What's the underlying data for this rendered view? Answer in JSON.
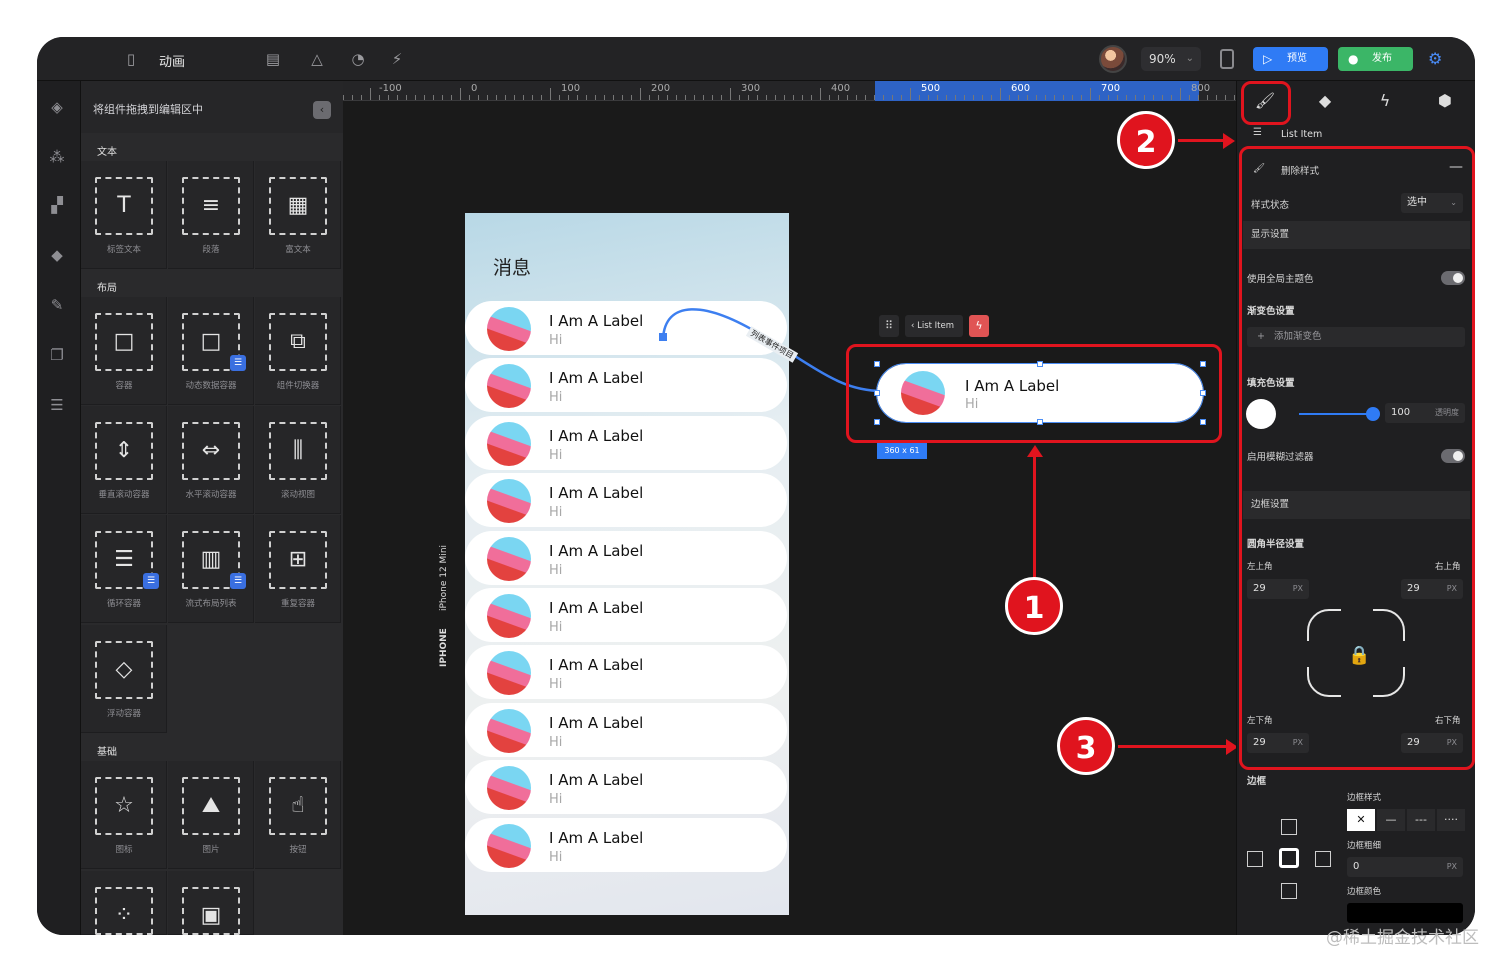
{
  "topbar": {
    "title": "动画",
    "zoom": "90%",
    "preview_label": "预览",
    "publish_label": "发布"
  },
  "panel": {
    "header": "将组件拖拽到编辑区中",
    "sections": {
      "text": "文本",
      "layout": "布局",
      "basic": "基础"
    },
    "text_items": [
      "标签文本",
      "段落",
      "富文本"
    ],
    "layout_items": [
      "容器",
      "动态数据容器",
      "组件切换器",
      "垂直滚动容器",
      "水平滚动容器",
      "滚动视图",
      "循环容器",
      "流式布局列表",
      "重复容器",
      "浮动容器"
    ],
    "basic_items": [
      "图标",
      "图片",
      "按钮"
    ]
  },
  "ruler": {
    "labels": [
      "-100",
      "0",
      "100",
      "200",
      "300",
      "400",
      "500",
      "600",
      "700",
      "800"
    ]
  },
  "phone": {
    "title": "消息",
    "device_model": "iPhone 12 Mini",
    "device_type": "IPHONE",
    "connector_label": "列表事件项目",
    "items": [
      {
        "label": "I Am A Label",
        "sub": "Hi"
      },
      {
        "label": "I Am A Label",
        "sub": "Hi"
      },
      {
        "label": "I Am A Label",
        "sub": "Hi"
      },
      {
        "label": "I Am A Label",
        "sub": "Hi"
      },
      {
        "label": "I Am A Label",
        "sub": "Hi"
      },
      {
        "label": "I Am A Label",
        "sub": "Hi"
      },
      {
        "label": "I Am A Label",
        "sub": "Hi"
      },
      {
        "label": "I Am A Label",
        "sub": "Hi"
      },
      {
        "label": "I Am A Label",
        "sub": "Hi"
      },
      {
        "label": "I Am A Label",
        "sub": "Hi"
      }
    ]
  },
  "selection": {
    "crumb": "List Item",
    "label": "I Am A Label",
    "sub": "Hi",
    "size": "360 x 61"
  },
  "annotations": [
    "1",
    "2",
    "3"
  ],
  "inspector": {
    "breadcrumb": "List Item",
    "style_header": "删除样式",
    "style_state_label": "样式状态",
    "style_state_value": "选中",
    "display_settings": "显示设置",
    "use_global_theme": "使用全局主题色",
    "gradient_settings": "渐变色设置",
    "add_gradient": "添加渐变色",
    "fill_settings": "填充色设置",
    "opacity_value": "100",
    "opacity_label": "透明度",
    "blur_filter": "启用模糊过滤器",
    "border_settings": "边框设置",
    "radius_settings": "圆角半径设置",
    "top_left": "左上角",
    "top_right": "右上角",
    "bottom_left": "左下角",
    "bottom_right": "右下角",
    "radius_value": "29",
    "unit": "PX",
    "border_title": "边框",
    "border_style": "边框样式",
    "border_width": "边框粗细",
    "border_width_value": "0",
    "border_color": "边框颜色"
  },
  "watermark": "@稀土掘金技术社区",
  "colors": {
    "accent_blue": "#2f7bf5",
    "publish_green": "#3bb667",
    "annotation_red": "#e0141e"
  }
}
